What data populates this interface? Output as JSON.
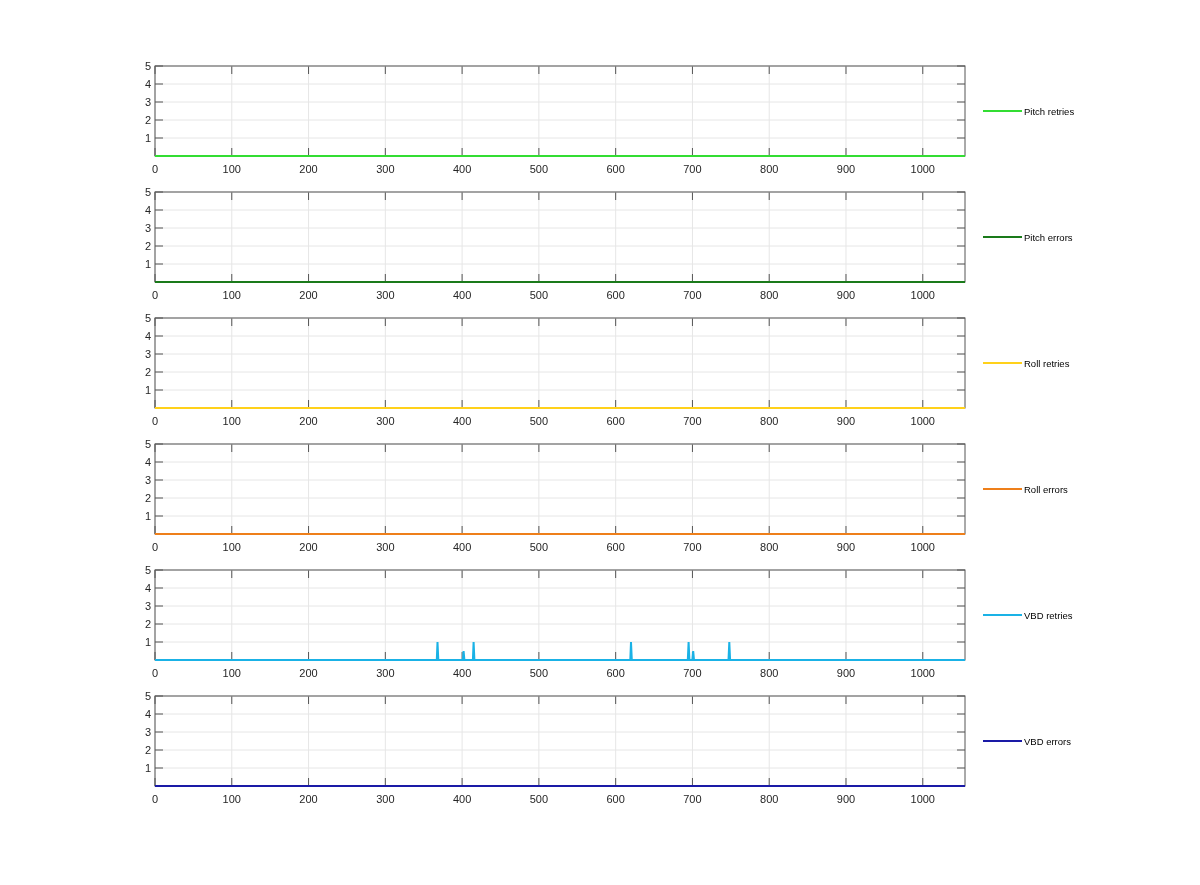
{
  "charts": [
    {
      "chart_data": {
        "type": "line",
        "x": [
          0,
          1055
        ],
        "grid": true,
        "series": [
          {
            "name": "Pitch retries",
            "color": "#33dd33",
            "values": [
              0,
              0
            ]
          }
        ],
        "xlim": [
          0,
          1055
        ],
        "ylim": [
          0,
          5
        ],
        "xticks": [
          0,
          100,
          200,
          300,
          400,
          500,
          600,
          700,
          800,
          900,
          1000
        ],
        "yticks": [
          1,
          2,
          3,
          4,
          5
        ]
      }
    },
    {
      "chart_data": {
        "type": "line",
        "x": [
          0,
          1055
        ],
        "grid": true,
        "series": [
          {
            "name": "Pitch errors",
            "color": "#1a7a1a",
            "values": [
              0,
              0
            ]
          }
        ],
        "xlim": [
          0,
          1055
        ],
        "ylim": [
          0,
          5
        ],
        "xticks": [
          0,
          100,
          200,
          300,
          400,
          500,
          600,
          700,
          800,
          900,
          1000
        ],
        "yticks": [
          1,
          2,
          3,
          4,
          5
        ]
      }
    },
    {
      "chart_data": {
        "type": "line",
        "x": [
          0,
          1055
        ],
        "grid": true,
        "series": [
          {
            "name": "Roll retries",
            "color": "#ffd11a",
            "values": [
              0,
              0
            ]
          }
        ],
        "xlim": [
          0,
          1055
        ],
        "ylim": [
          0,
          5
        ],
        "xticks": [
          0,
          100,
          200,
          300,
          400,
          500,
          600,
          700,
          800,
          900,
          1000
        ],
        "yticks": [
          1,
          2,
          3,
          4,
          5
        ]
      }
    },
    {
      "chart_data": {
        "type": "line",
        "x": [
          0,
          1055
        ],
        "grid": true,
        "series": [
          {
            "name": "Roll errors",
            "color": "#ee7f1a",
            "values": [
              0,
              0
            ]
          }
        ],
        "xlim": [
          0,
          1055
        ],
        "ylim": [
          0,
          5
        ],
        "xticks": [
          0,
          100,
          200,
          300,
          400,
          500,
          600,
          700,
          800,
          900,
          1000
        ],
        "yticks": [
          1,
          2,
          3,
          4,
          5
        ]
      }
    },
    {
      "chart_data": {
        "type": "line",
        "x": [
          0,
          367,
          368,
          369,
          401,
          402,
          403,
          414,
          415,
          416,
          619,
          620,
          621,
          694,
          695,
          696,
          700,
          701,
          702,
          747,
          748,
          749,
          1055
        ],
        "grid": true,
        "series": [
          {
            "name": "VBD retries",
            "color": "#1ab2e6",
            "values": [
              0,
              0,
              1,
              0,
              0,
              0.5,
              0,
              0,
              1,
              0,
              0,
              1,
              0,
              0,
              1,
              0,
              0,
              0.5,
              0,
              0,
              1,
              0,
              0
            ]
          }
        ],
        "xlim": [
          0,
          1055
        ],
        "ylim": [
          0,
          5
        ],
        "xticks": [
          0,
          100,
          200,
          300,
          400,
          500,
          600,
          700,
          800,
          900,
          1000
        ],
        "yticks": [
          1,
          2,
          3,
          4,
          5
        ]
      }
    },
    {
      "chart_data": {
        "type": "line",
        "x": [
          0,
          1055
        ],
        "grid": true,
        "series": [
          {
            "name": "VBD errors",
            "color": "#1a1aa6",
            "values": [
              0,
              0
            ]
          }
        ],
        "xlim": [
          0,
          1055
        ],
        "ylim": [
          0,
          5
        ],
        "xticks": [
          0,
          100,
          200,
          300,
          400,
          500,
          600,
          700,
          800,
          900,
          1000
        ],
        "yticks": [
          1,
          2,
          3,
          4,
          5
        ]
      }
    }
  ]
}
